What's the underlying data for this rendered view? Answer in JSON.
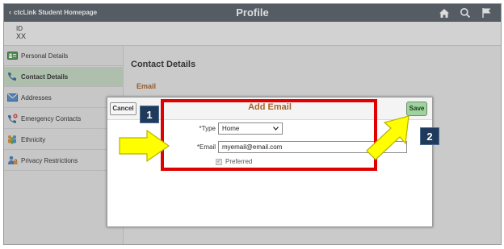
{
  "header": {
    "back_link": "ctcLink Student Homepage",
    "title": "Profile"
  },
  "profile": {
    "id_label": "ID",
    "id_value": "XX"
  },
  "sidebar": {
    "items": [
      {
        "label": "Personal Details",
        "icon": "id-card-icon"
      },
      {
        "label": "Contact Details",
        "icon": "phone-icon",
        "active": true
      },
      {
        "label": "Addresses",
        "icon": "envelope-icon"
      },
      {
        "label": "Emergency Contacts",
        "icon": "emergency-phone-icon"
      },
      {
        "label": "Ethnicity",
        "icon": "people-icon"
      },
      {
        "label": "Privacy Restrictions",
        "icon": "person-lock-icon"
      }
    ]
  },
  "main": {
    "section_title": "Contact Details",
    "email_heading": "Email"
  },
  "modal": {
    "title": "Add Email",
    "cancel_label": "Cancel",
    "save_label": "Save",
    "type_label": "*Type",
    "type_value": "Home",
    "email_label": "*Email",
    "email_value": "myemail@email.com",
    "preferred_label": "Preferred",
    "preferred_checked": true
  },
  "annotations": {
    "step_1": "1",
    "step_2": "2"
  },
  "colors": {
    "header_bg": "#5c636d",
    "accent_orange": "#a8622a",
    "active_nav": "#c7dcc7",
    "save_button": "#9fd29f",
    "highlight_red": "#e00000",
    "arrow_yellow": "#ffff00",
    "badge_navy": "#1f3a5a"
  }
}
